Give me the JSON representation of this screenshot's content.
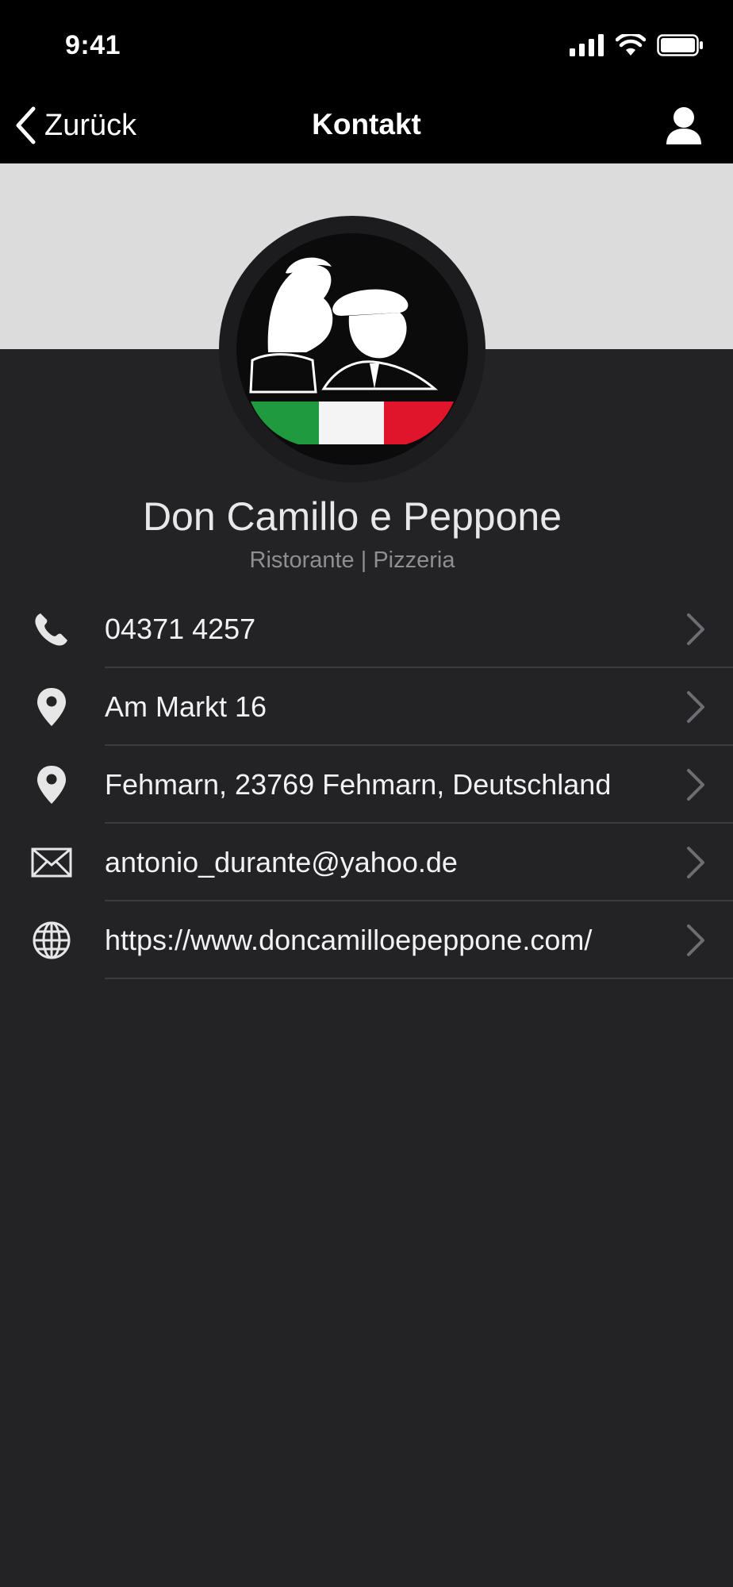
{
  "status_bar": {
    "time": "9:41"
  },
  "nav": {
    "back_label": "Zurück",
    "title": "Kontakt"
  },
  "restaurant": {
    "name": "Don Camillo e Peppone",
    "subtitle": "Ristorante | Pizzeria"
  },
  "contacts": [
    {
      "icon": "phone-icon",
      "text": "04371 4257"
    },
    {
      "icon": "location-pin-icon",
      "text": "Am Markt 16"
    },
    {
      "icon": "location-pin-icon",
      "text": "Fehmarn, 23769 Fehmarn, Deutschland"
    },
    {
      "icon": "mail-icon",
      "text": "antonio_durante@yahoo.de"
    },
    {
      "icon": "globe-icon",
      "text": "https://www.doncamilloepeppone.com/"
    }
  ],
  "colors": {
    "background": "#232326",
    "bar": "#000000",
    "header_band": "#dcdcdc",
    "flag_green": "#1f9a3e",
    "flag_white": "#f4f4f4",
    "flag_red": "#e0152b"
  }
}
